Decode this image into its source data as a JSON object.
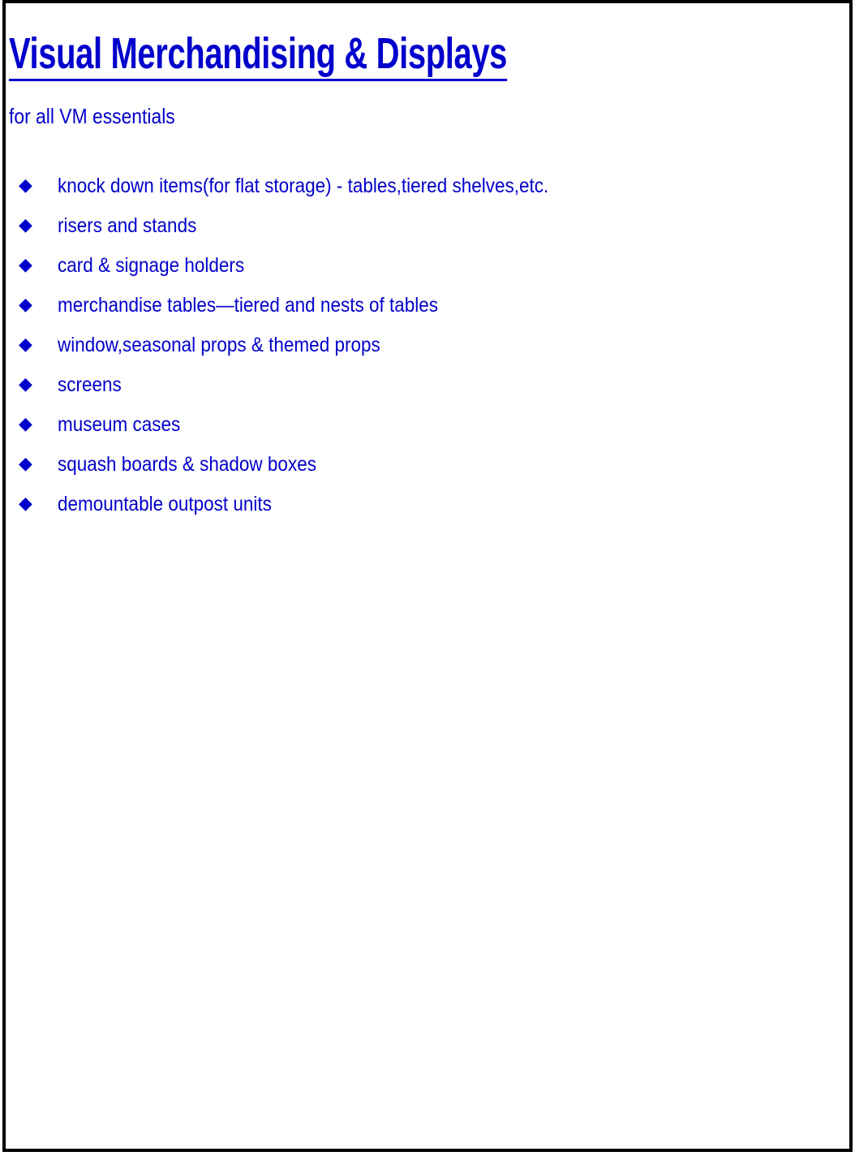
{
  "document": {
    "title": "Visual Merchandising & Displays",
    "subtitle": "for all VM essentials",
    "bullet_glyph": "◆",
    "text_color": "#0000CC",
    "background_color": "#FFFFFF",
    "border_color": "#000000",
    "items": [
      {
        "label": "knock down items(for flat storage) - tables,tiered shelves,etc."
      },
      {
        "label": "risers and stands"
      },
      {
        "label": "card & signage holders"
      },
      {
        "label": "merchandise tables—tiered and nests of tables"
      },
      {
        "label": "window,seasonal props & themed props"
      },
      {
        "label": "screens"
      },
      {
        "label": "museum cases"
      },
      {
        "label": "squash boards & shadow boxes"
      },
      {
        "label": "demountable outpost units"
      }
    ]
  }
}
